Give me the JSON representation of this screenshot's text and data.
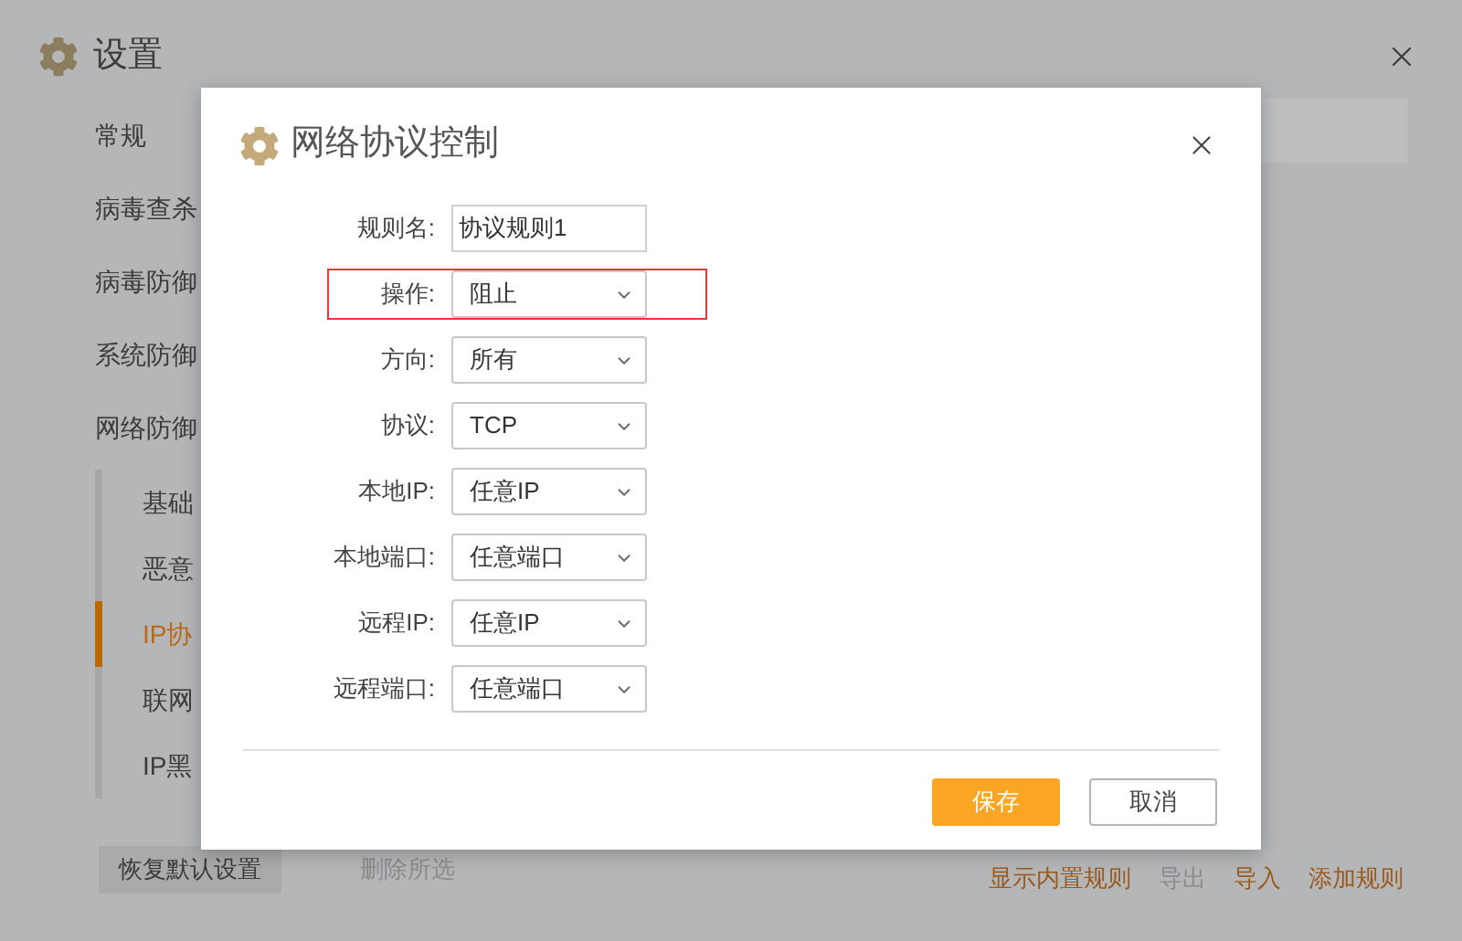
{
  "background": {
    "title": "设置",
    "nav": [
      {
        "label": "常规",
        "selected": false
      },
      {
        "label": "病毒查杀",
        "selected": false
      },
      {
        "label": "病毒防御",
        "selected": false
      },
      {
        "label": "系统防御",
        "selected": false
      },
      {
        "label": "网络防御",
        "selected": false,
        "children": [
          {
            "label": "基础",
            "selected": false
          },
          {
            "label": "恶意",
            "selected": false
          },
          {
            "label": "IP协",
            "selected": true
          },
          {
            "label": "联网",
            "selected": false
          },
          {
            "label": "IP黑",
            "selected": false
          }
        ]
      }
    ],
    "footer": {
      "restore_button": "恢复默认设置",
      "links_left": [
        {
          "label": "删除所选",
          "disabled": true
        }
      ],
      "links_right": [
        {
          "label": "显示内置规则",
          "disabled": false
        },
        {
          "label": "导出",
          "disabled": true
        },
        {
          "label": "导入",
          "disabled": false
        },
        {
          "label": "添加规则",
          "disabled": false
        }
      ]
    }
  },
  "dialog": {
    "title": "网络协议控制",
    "fields": [
      {
        "label": "规则名:",
        "kind": "text",
        "value": "协议规则1",
        "highlighted": false
      },
      {
        "label": "操作:",
        "kind": "select",
        "value": "阻止",
        "highlighted": true
      },
      {
        "label": "方向:",
        "kind": "select",
        "value": "所有",
        "highlighted": false
      },
      {
        "label": "协议:",
        "kind": "select",
        "value": "TCP",
        "highlighted": false
      },
      {
        "label": "本地IP:",
        "kind": "select",
        "value": "任意IP",
        "highlighted": false
      },
      {
        "label": "本地端口:",
        "kind": "select",
        "value": "任意端口",
        "highlighted": false
      },
      {
        "label": "远程IP:",
        "kind": "select",
        "value": "任意IP",
        "highlighted": false
      },
      {
        "label": "远程端口:",
        "kind": "select",
        "value": "任意端口",
        "highlighted": false
      }
    ],
    "buttons": [
      {
        "label": "保存",
        "kind": "primary"
      },
      {
        "label": "取消",
        "kind": "secondary"
      }
    ]
  }
}
